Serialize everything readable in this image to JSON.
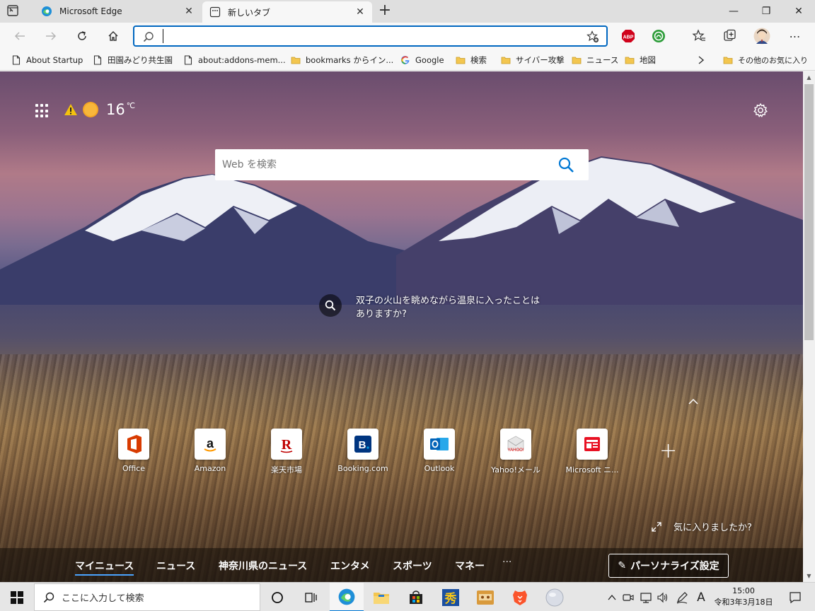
{
  "tabs": [
    {
      "title": "Microsoft Edge"
    },
    {
      "title": "新しいタブ"
    }
  ],
  "window": {
    "minimize": "—",
    "maximize": "❐",
    "close": "✕"
  },
  "toolbar": {
    "address_value": "",
    "extensions": [
      "ABP"
    ]
  },
  "bookmarks": [
    {
      "label": "About Startup",
      "icon": "page-icon"
    },
    {
      "label": "田園みどり共生園",
      "icon": "page-icon"
    },
    {
      "label": "about:addons-mem...",
      "icon": "page-icon"
    },
    {
      "label": "bookmarks からイン...",
      "icon": "folder-icon"
    },
    {
      "label": "Google",
      "icon": "google-icon"
    },
    {
      "label": "検索",
      "icon": "folder-icon"
    },
    {
      "label": "サイバー攻撃",
      "icon": "folder-icon"
    },
    {
      "label": "ニュース",
      "icon": "folder-icon"
    },
    {
      "label": "地図",
      "icon": "folder-icon"
    },
    {
      "label": "その他のお気に入り",
      "icon": "folder-icon"
    }
  ],
  "newtab": {
    "weather": {
      "temp": "16",
      "unit": "℃"
    },
    "search_placeholder": "Web を検索",
    "image_info": "双子の火山を眺めながら温泉に入ったことはありますか?",
    "quick_links": [
      {
        "label": "Office"
      },
      {
        "label": "Amazon"
      },
      {
        "label": "楽天市場"
      },
      {
        "label": "Booking.com"
      },
      {
        "label": "Outlook"
      },
      {
        "label": "Yahoo!メール"
      },
      {
        "label": "Microsoft ニ..."
      }
    ],
    "like_prompt": "気に入りましたか?",
    "news_tabs": [
      "マイニュース",
      "ニュース",
      "神奈川県のニュース",
      "エンタメ",
      "スポーツ",
      "マネー"
    ],
    "news_more": "···",
    "personalize_label": "パーソナライズ設定"
  },
  "taskbar": {
    "search_placeholder": "ここに入力して検索",
    "ime": "A",
    "time": "15:00",
    "date": "令和3年3月18日"
  },
  "colors": {
    "accent": "#0067c0",
    "search_icon": "#0078d4"
  }
}
